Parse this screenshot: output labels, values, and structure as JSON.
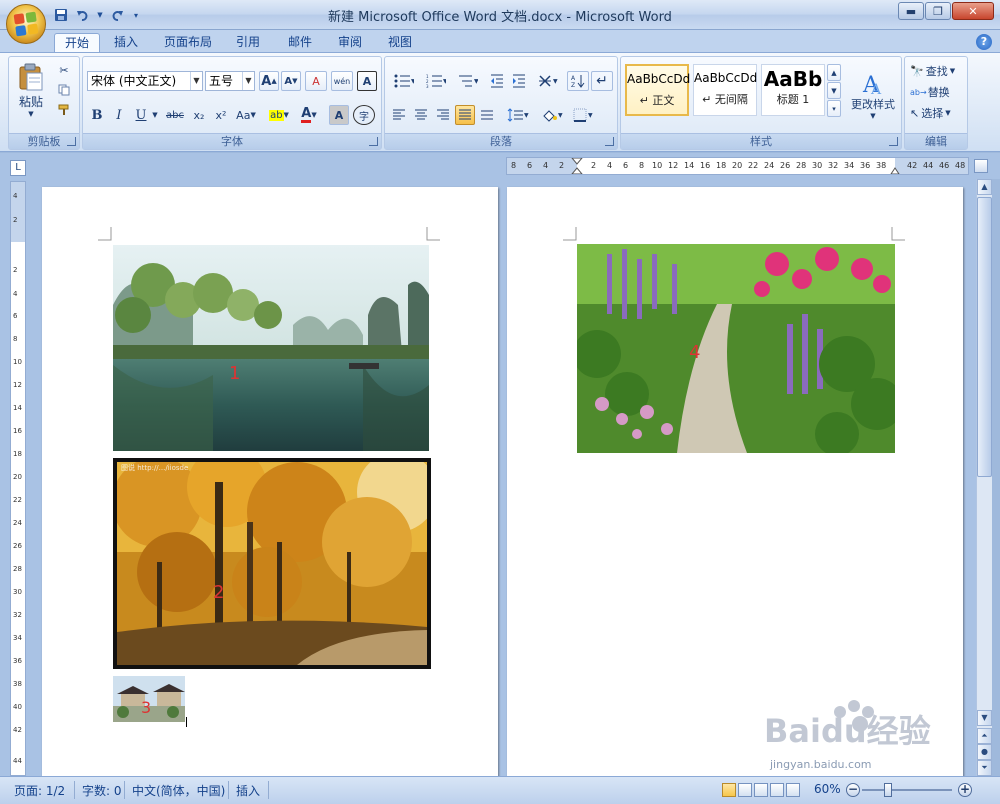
{
  "window": {
    "title": "新建 Microsoft Office Word 文档.docx - Microsoft Word",
    "controls": [
      "minimize",
      "maximize",
      "close"
    ]
  },
  "qat": [
    "save-icon",
    "undo-icon",
    "redo-icon",
    "customize-icon"
  ],
  "tabs": [
    "开始",
    "插入",
    "页面布局",
    "引用",
    "邮件",
    "审阅",
    "视图"
  ],
  "active_tab": "开始",
  "ribbon": {
    "clipboard": {
      "label": "剪贴板",
      "paste": "粘贴"
    },
    "font": {
      "label": "字体",
      "font_name": "宋体 (中文正文)",
      "font_size": "五号",
      "grow": "A",
      "shrink": "A",
      "clear": "A",
      "phonetic": "wén",
      "border_char": "A",
      "bold": "B",
      "italic": "I",
      "underline": "U",
      "strike": "abc",
      "subscript": "x₂",
      "superscript": "x²",
      "change_case": "Aa",
      "highlight": "ab",
      "font_color": "A",
      "char_shade": "A",
      "enclose": "字"
    },
    "paragraph": {
      "label": "段落"
    },
    "styles": {
      "label": "样式",
      "items": [
        {
          "sample": "AaBbCcDd",
          "name": "↵ 正文"
        },
        {
          "sample": "AaBbCcDd",
          "name": "↵ 无间隔"
        },
        {
          "sample": "AaBb",
          "name": "标题 1"
        }
      ],
      "change_styles": "更改样式"
    },
    "editing": {
      "label": "编辑",
      "find": "查找",
      "replace": "替换",
      "select": "选择"
    }
  },
  "ruler": {
    "left_ticks": [
      "8",
      "6",
      "4",
      "2"
    ],
    "right_ticks": [
      "2",
      "4",
      "6",
      "8",
      "10",
      "12",
      "14",
      "16",
      "18",
      "20",
      "22",
      "24",
      "26",
      "28",
      "30",
      "32",
      "34",
      "36",
      "38",
      "42",
      "44",
      "46",
      "48"
    ],
    "v_ticks": [
      "4",
      "2",
      "2",
      "4",
      "6",
      "8",
      "10",
      "12",
      "14",
      "16",
      "18",
      "20",
      "22",
      "24",
      "26",
      "28",
      "30",
      "32",
      "34",
      "36",
      "38",
      "40",
      "42",
      "44"
    ]
  },
  "pictures": [
    {
      "label": "1",
      "subject": "karst river landscape"
    },
    {
      "label": "2",
      "subject": "autumn golden forest",
      "caption_watermark": "图说 http://.../iiosde"
    },
    {
      "label": "3",
      "subject": "pagoda pavilion (small)"
    },
    {
      "label": "4",
      "subject": "flower garden stone path"
    }
  ],
  "status": {
    "page": "页面: 1/2",
    "words": "字数: 0",
    "language": "中文(简体，中国)",
    "mode": "插入",
    "zoom": "60%"
  },
  "watermark": {
    "brand": "Baidu经验",
    "url": "jingyan.baidu.com"
  },
  "colors": {
    "ribbon_blue": "#15428b",
    "frame_blue": "#a9c2e4",
    "picture_label": "#dd3333"
  }
}
